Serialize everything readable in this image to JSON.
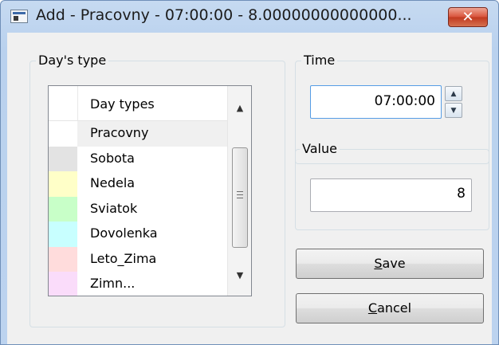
{
  "window": {
    "title": "Add - Pracovny - 07:00:00 - 8.00000000000000...",
    "close_glyph": "✕"
  },
  "days_group": {
    "label": "Day's type",
    "header": "Day types",
    "rows": [
      {
        "label": "Pracovny",
        "color": "#ffffff",
        "selected": true
      },
      {
        "label": "Sobota",
        "color": "#e3e3e3"
      },
      {
        "label": "Nedela",
        "color": "#ffffc8"
      },
      {
        "label": "Sviatok",
        "color": "#c8ffc8"
      },
      {
        "label": "Dovolenka",
        "color": "#c8ffff"
      },
      {
        "label": "Leto_Zima",
        "color": "#ffdcdc"
      },
      {
        "label": "Zimn...",
        "color": "#fadcfa"
      }
    ]
  },
  "time_group": {
    "label": "Time",
    "value": "07:00:00"
  },
  "value_group": {
    "label": "Value",
    "value": "8"
  },
  "buttons": {
    "save_mnemonic": "S",
    "save_rest": "ave",
    "cancel_mnemonic": "C",
    "cancel_rest": "ancel"
  },
  "icons": [
    "window-app-icon",
    "close-icon",
    "scroll-up-icon",
    "scroll-down-icon",
    "spin-up-icon",
    "spin-down-icon"
  ]
}
